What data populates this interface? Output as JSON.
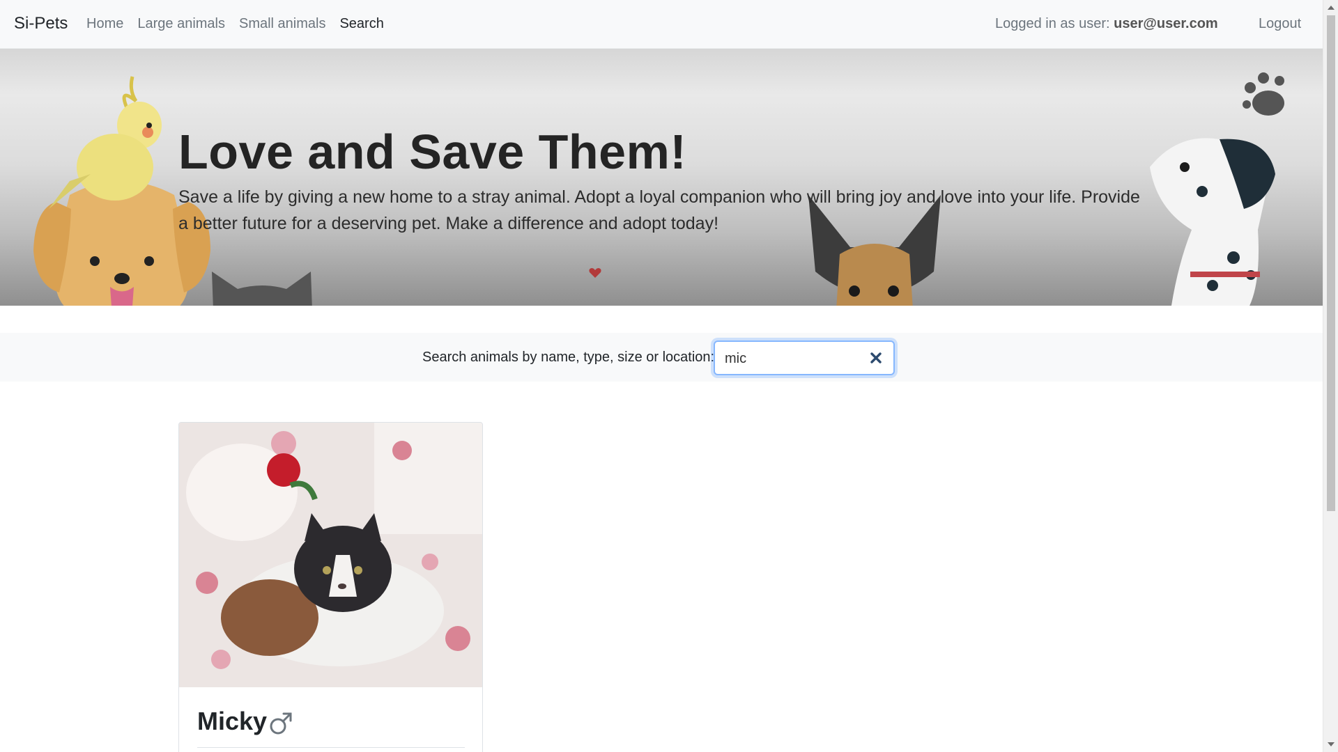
{
  "navbar": {
    "brand": "Si-Pets",
    "links": [
      {
        "label": "Home"
      },
      {
        "label": "Large animals"
      },
      {
        "label": "Small animals"
      },
      {
        "label": "Search"
      }
    ],
    "user_prefix": "Logged in as user:",
    "user_email": "user@user.com",
    "logout_label": "Logout"
  },
  "hero": {
    "title": "Love and Save Them!",
    "text": "Save a life by giving a new home to a stray animal. Adopt a loyal companion who will bring joy and love into your life. Provide a better future for a deserving pet. Make a difference and adopt today!",
    "icons": [
      "cockatiel-icon",
      "golden-dog-icon",
      "cat-icon",
      "german-shepherd-icon",
      "dalmatian-icon",
      "paw-icon",
      "heart-icon"
    ]
  },
  "search": {
    "label": "Search animals by name, type, size or location:",
    "value": "mic",
    "clear_icon": "close-icon"
  },
  "results": [
    {
      "name": "Micky",
      "gender_icon": "male-icon",
      "photo": "persian-cat-photo"
    }
  ],
  "colors": {
    "navbar_bg": "#f8f9fa",
    "focus_ring": "#86b7fe",
    "link_muted": "#6c757d"
  }
}
